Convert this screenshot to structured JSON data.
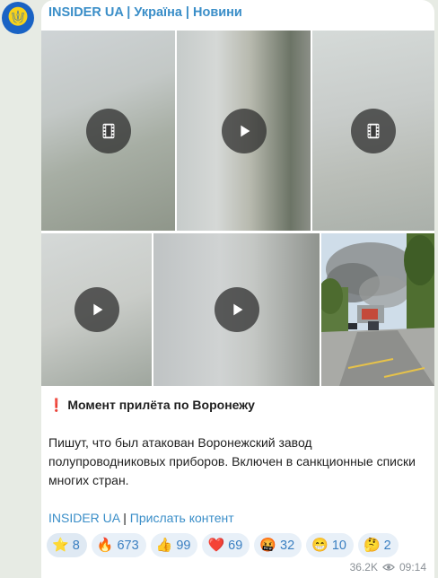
{
  "channel": {
    "name": "INSIDER UA | Україна | Новини",
    "avatar_icon": "trident-icon"
  },
  "media": [
    {
      "kind": "video",
      "icon": "film-icon"
    },
    {
      "kind": "video",
      "icon": "play-icon"
    },
    {
      "kind": "video",
      "icon": "film-icon"
    },
    {
      "kind": "video",
      "icon": "play-icon"
    },
    {
      "kind": "video",
      "icon": "play-icon"
    },
    {
      "kind": "photo",
      "icon": "photo-street-smoke"
    }
  ],
  "post": {
    "title_prefix": "❗️",
    "title": "Момент прилёта по Воронежу",
    "paragraph": "Пишут, что был атакован Воронежский завод полупроводниковых приборов. Включен в санкционные списки многих стран.",
    "link_insider": "INSIDER UA",
    "link_separator": " | ",
    "link_submit": "Прислать контент"
  },
  "reactions": [
    {
      "emoji": "⭐",
      "count": "8"
    },
    {
      "emoji": "🔥",
      "count": "673"
    },
    {
      "emoji": "👍",
      "count": "99"
    },
    {
      "emoji": "❤️",
      "count": "69"
    },
    {
      "emoji": "🤬",
      "count": "32"
    },
    {
      "emoji": "😁",
      "count": "10"
    },
    {
      "emoji": "🤔",
      "count": "2"
    }
  ],
  "meta": {
    "views": "36.2K",
    "time": "09:14",
    "views_icon": "eye-icon"
  },
  "colors": {
    "accent": "#3a8ec8",
    "background": "#e7ebe4",
    "bubble": "#ffffff"
  }
}
